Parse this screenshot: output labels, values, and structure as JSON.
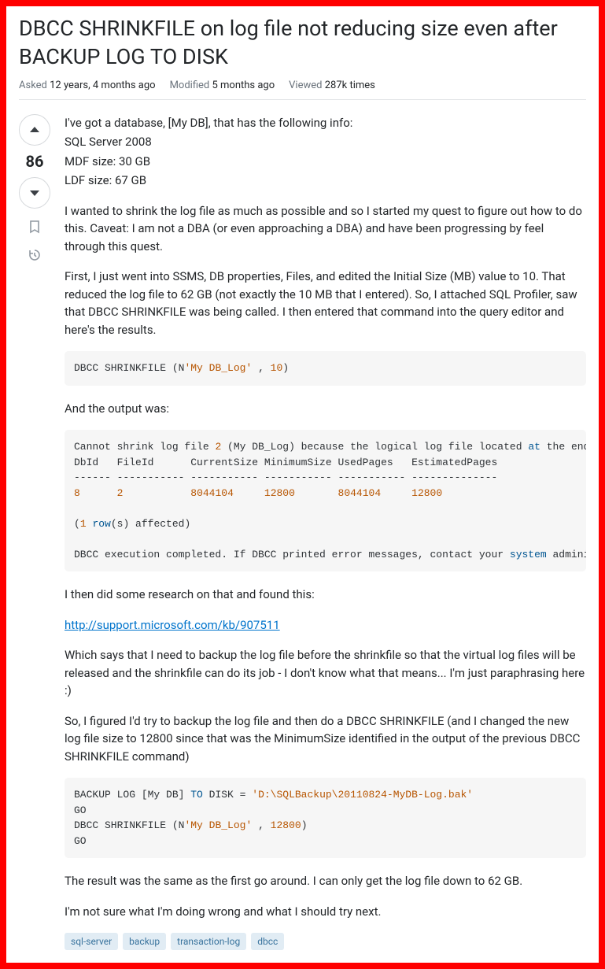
{
  "title": "DBCC SHRINKFILE on log file not reducing size even after BACKUP LOG TO DISK",
  "meta": {
    "asked_label": "Asked",
    "asked_value": "12 years, 4 months ago",
    "modified_label": "Modified",
    "modified_value": "5 months ago",
    "viewed_label": "Viewed",
    "viewed_value": "287k times"
  },
  "vote": {
    "score": "86"
  },
  "body": {
    "p1a": "I've got a database, [My DB], that has the following info:",
    "p1b": "SQL Server 2008",
    "p1c": "MDF size: 30 GB",
    "p1d": "LDF size: 67 GB",
    "p2": "I wanted to shrink the log file as much as possible and so I started my quest to figure out how to do this. Caveat: I am not a DBA (or even approaching a DBA) and have been progressing by feel through this quest.",
    "p3": "First, I just went into SSMS, DB properties, Files, and edited the Initial Size (MB) value to 10. That reduced the log file to 62 GB (not exactly the 10 MB that I entered). So, I attached SQL Profiler, saw that DBCC SHRINKFILE was being called. I then entered that command into the query editor and here's the results.",
    "p4": "And the output was:",
    "p5": "I then did some research on that and found this:",
    "link": "http://support.microsoft.com/kb/907511",
    "p6": "Which says that I need to backup the log file before the shrinkfile so that the virtual log files will be released and the shrinkfile can do its job - I don't know what that means... I'm just paraphrasing here :)",
    "p7": "So, I figured I'd try to backup the log file and then do a DBCC SHRINKFILE (and I changed the new log file size to 12800 since that was the MinimumSize identified in the output of the previous DBCC SHRINKFILE command)",
    "p8": "The result was the same as the first go around. I can only get the log file down to 62 GB.",
    "p9": "I'm not sure what I'm doing wrong and what I should try next."
  },
  "code1": {
    "t1": "DBCC SHRINKFILE (N",
    "s1": "'My DB_Log'",
    "t2": " , ",
    "n1": "10",
    "t3": ")"
  },
  "code2": {
    "l1a": "Cannot shrink log file ",
    "l1n": "2",
    "l1b": " (My DB_Log) because the logical log file located ",
    "l1k": "at",
    "l1c": " the end of the file is in use.",
    "l2": "DbId   FileId      CurrentSize MinimumSize UsedPages   EstimatedPages",
    "l3": "------ ----------- ----------- ----------- ----------- --------------",
    "l4a": "8",
    "l4b": "2",
    "l4c": "8044104",
    "l4d": "12800",
    "l4e": "8044104",
    "l4f": "12800",
    "l5a": "(",
    "l5n": "1",
    "l5b": " ",
    "l5k": "row",
    "l5c": "(s) affected)",
    "l6a": "DBCC execution completed. If DBCC printed error messages, contact your ",
    "l6k": "system",
    "l6b": " administrator."
  },
  "code3": {
    "l1a": "BACKUP LOG [My DB] ",
    "l1k": "TO",
    "l1b": " DISK = ",
    "l1s": "'D:\\SQLBackup\\20110824-MyDB-Log.bak'",
    "l2": "GO",
    "l3a": "DBCC SHRINKFILE (N",
    "l3s": "'My DB_Log'",
    "l3b": " , ",
    "l3n": "12800",
    "l3c": ")",
    "l4": "GO"
  },
  "tags": [
    "sql-server",
    "backup",
    "transaction-log",
    "dbcc"
  ]
}
